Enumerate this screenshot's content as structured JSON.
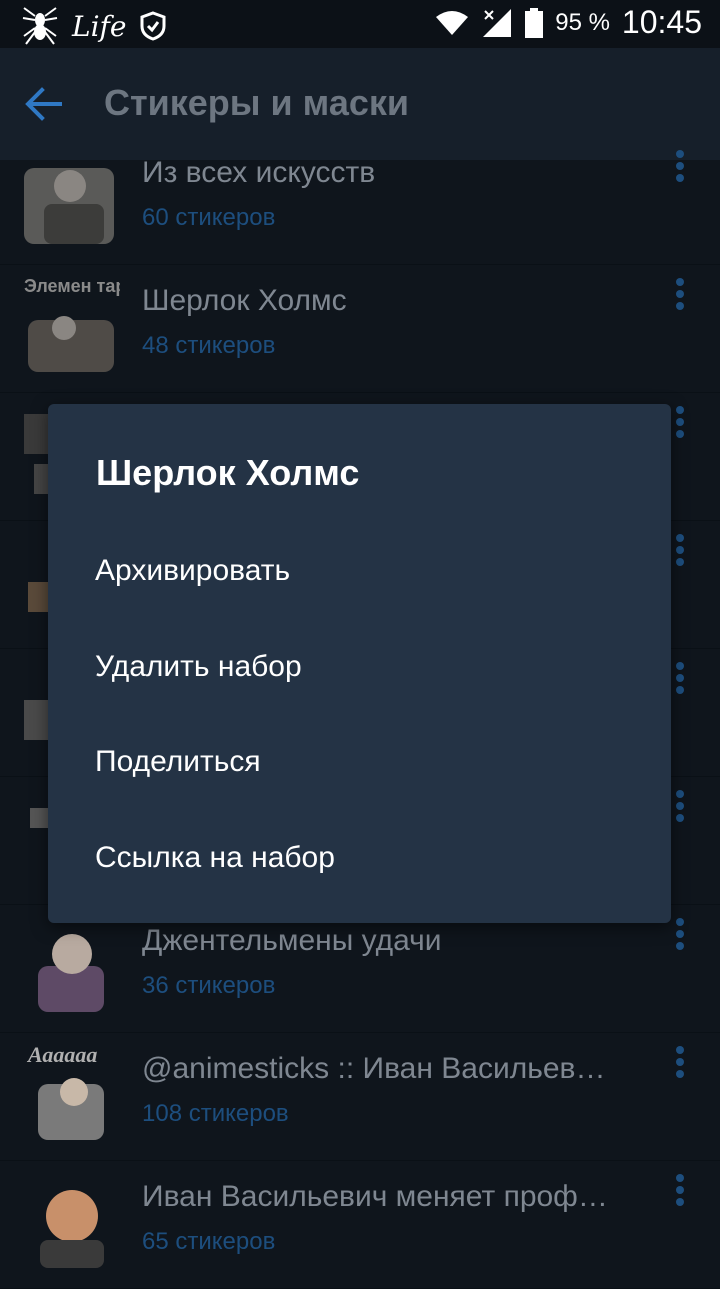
{
  "statusbar": {
    "carrier": "Life",
    "battery": "95 %",
    "time": "10:45"
  },
  "appbar": {
    "title": "Стикеры и маски"
  },
  "sticker_sets": [
    {
      "name": "Из всех искусств",
      "count": "60 стикеров"
    },
    {
      "name": "Шерлок Холмс",
      "count": "48 стикеров"
    },
    {
      "name": "",
      "count": ""
    },
    {
      "name": "",
      "count": ""
    },
    {
      "name": "",
      "count": ""
    },
    {
      "name": "",
      "count": ""
    },
    {
      "name": "Джентельмены удачи",
      "count": "36 стикеров"
    },
    {
      "name": "@animesticks :: Иван Васильев…",
      "count": "108 стикеров"
    },
    {
      "name": "Иван Васильевич меняет проф…",
      "count": "65 стикеров"
    }
  ],
  "thumb_labels": {
    "sherlock": "Элемен тарно",
    "animesticks": "Аааааа"
  },
  "dialog": {
    "title": "Шерлок Холмс",
    "items": [
      "Архивировать",
      "Удалить набор",
      "Поделиться",
      "Ссылка на набор"
    ]
  },
  "colors": {
    "background": "#0f151c",
    "appbar": "#161f2a",
    "dialog": "#243345",
    "accent": "#2f78c4",
    "count_text": "#1d4e7e"
  }
}
